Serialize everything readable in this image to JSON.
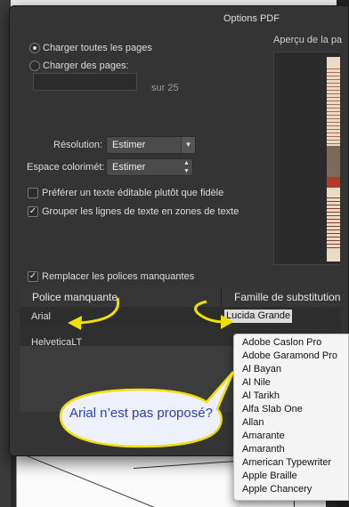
{
  "dialog": {
    "title": "Options PDF"
  },
  "pages": {
    "option_all": "Charger toutes les pages",
    "option_range": "Charger des pages:",
    "range_value": "",
    "range_suffix": "sur 25",
    "selected": "all"
  },
  "settings": {
    "resolution_label": "Résolution:",
    "resolution_value": "Estimer",
    "colorspace_label": "Espace colorimét:",
    "colorspace_value": "Estimer",
    "prefer_editable_label": "Préférer un texte éditable plutôt que fidèle",
    "prefer_editable_checked": false,
    "group_lines_label": "Grouper les lignes de texte en zones de texte",
    "group_lines_checked": true
  },
  "preview": {
    "label": "Aperçu de la pa"
  },
  "fonts": {
    "replace_label": "Remplacer les polices manquantes",
    "replace_checked": true,
    "col_missing": "Police manquante",
    "col_substitute": "Famille de substitution",
    "rows": [
      {
        "missing": "Arial",
        "substitute": "Lucida Grande"
      },
      {
        "missing": "HelveticaLT",
        "substitute": ""
      }
    ]
  },
  "dropdown": {
    "items": [
      "Adobe Caslon Pro",
      "Adobe Garamond Pro",
      "Al Bayan",
      "Al Nile",
      "Al Tarikh",
      "Alfa Slab One",
      "Allan",
      "Amarante",
      "Amaranth",
      "American Typewriter",
      "Apple Braille",
      "Apple Chancery"
    ]
  },
  "annotation": {
    "callout_text": "Arial n’est pas proposé?",
    "callout_color": "#2b3fb3",
    "arrow_color": "#f0e000",
    "bubble_fill": "#eef0fb"
  }
}
